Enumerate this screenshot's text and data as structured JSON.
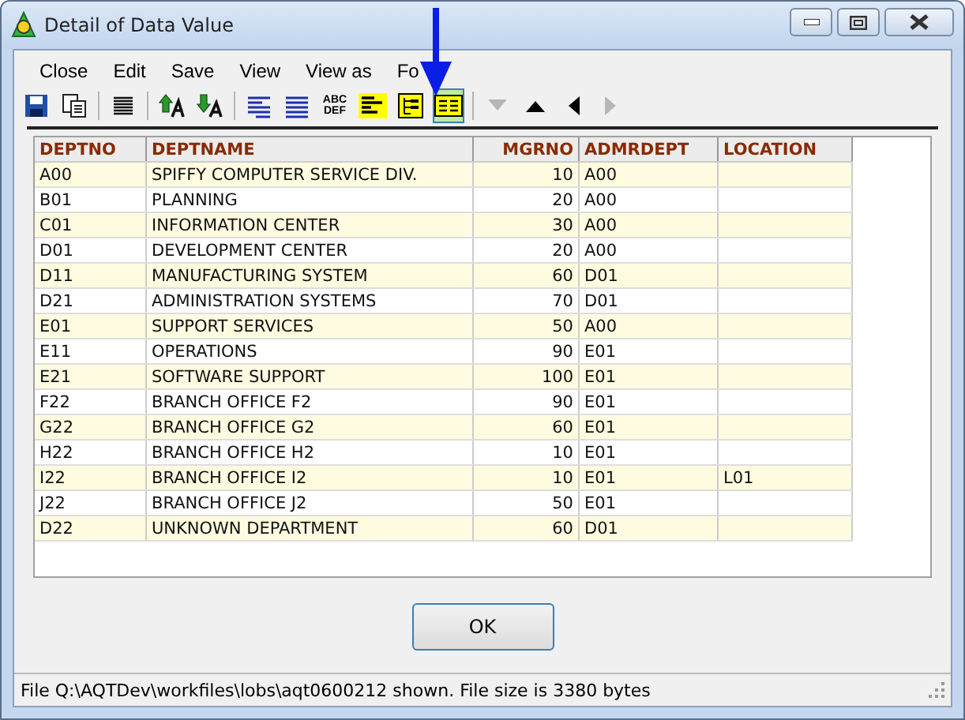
{
  "window": {
    "title": "Detail of Data Value"
  },
  "menu": [
    "Close",
    "Edit",
    "Save",
    "View",
    "View as",
    "Fo"
  ],
  "toolbar": [
    [
      {
        "kind": "save",
        "selected": false,
        "disabled": false
      },
      {
        "kind": "copy",
        "selected": false,
        "disabled": false
      }
    ],
    [
      {
        "kind": "lines",
        "selected": false,
        "disabled": false
      }
    ],
    [
      {
        "kind": "sort-up",
        "selected": false,
        "disabled": false
      },
      {
        "kind": "sort-down",
        "selected": false,
        "disabled": false
      }
    ],
    [
      {
        "kind": "wrap",
        "selected": false,
        "disabled": false
      },
      {
        "kind": "justify",
        "selected": false,
        "disabled": false
      },
      {
        "kind": "text",
        "label": "ABC DEF",
        "selected": false,
        "disabled": false
      },
      {
        "kind": "bars",
        "selected": false,
        "disabled": false
      },
      {
        "kind": "tree",
        "selected": false,
        "disabled": false
      },
      {
        "kind": "grid",
        "selected": true,
        "disabled": false
      }
    ],
    [
      {
        "kind": "down",
        "selected": false,
        "disabled": true
      },
      {
        "kind": "up",
        "selected": false,
        "disabled": false
      },
      {
        "kind": "left",
        "selected": false,
        "disabled": false
      },
      {
        "kind": "right",
        "selected": false,
        "disabled": true
      }
    ]
  ],
  "table": {
    "columns": [
      "DEPTNO",
      "DEPTNAME",
      "MGRNO",
      "ADMRDEPT",
      "LOCATION"
    ],
    "rows": [
      {
        "deptno": "A00",
        "deptname": "SPIFFY COMPUTER SERVICE DIV.",
        "mgrno": "10",
        "admrdept": "A00"
      },
      {
        "deptno": "B01",
        "deptname": "PLANNING",
        "mgrno": "20",
        "admrdept": "A00"
      },
      {
        "deptno": "C01",
        "deptname": "INFORMATION CENTER",
        "mgrno": "30",
        "admrdept": "A00"
      },
      {
        "deptno": "D01",
        "deptname": "DEVELOPMENT CENTER",
        "mgrno": "20",
        "admrdept": "A00"
      },
      {
        "deptno": "D11",
        "deptname": "MANUFACTURING SYSTEM",
        "mgrno": "60",
        "admrdept": "D01"
      },
      {
        "deptno": "D21",
        "deptname": "ADMINISTRATION SYSTEMS",
        "mgrno": "70",
        "admrdept": "D01"
      },
      {
        "deptno": "E01",
        "deptname": "SUPPORT SERVICES",
        "mgrno": "50",
        "admrdept": "A00"
      },
      {
        "deptno": "E11",
        "deptname": "OPERATIONS",
        "mgrno": "90",
        "admrdept": "E01"
      },
      {
        "deptno": "E21",
        "deptname": "SOFTWARE SUPPORT",
        "mgrno": "100",
        "admrdept": "E01"
      },
      {
        "deptno": "F22",
        "deptname": "BRANCH OFFICE F2",
        "mgrno": "90",
        "admrdept": "E01"
      },
      {
        "deptno": "G22",
        "deptname": "BRANCH OFFICE G2",
        "mgrno": "60",
        "admrdept": "E01"
      },
      {
        "deptno": "H22",
        "deptname": "BRANCH OFFICE H2",
        "mgrno": "10",
        "admrdept": "E01"
      },
      {
        "deptno": "I22",
        "deptname": "BRANCH OFFICE I2",
        "mgrno": "10",
        "admrdept": "E01",
        "location": "L01"
      },
      {
        "deptno": "J22",
        "deptname": "BRANCH OFFICE J2",
        "mgrno": "50",
        "admrdept": "E01"
      },
      {
        "deptno": "D22",
        "deptname": "UNKNOWN DEPARTMENT",
        "mgrno": "60",
        "admrdept": "D01"
      }
    ]
  },
  "buttons": [
    "OK"
  ],
  "status_bar": "File Q:\\AQTDev\\workfiles\\lobs\\aqt0600212 shown. File size is 3380 bytes"
}
